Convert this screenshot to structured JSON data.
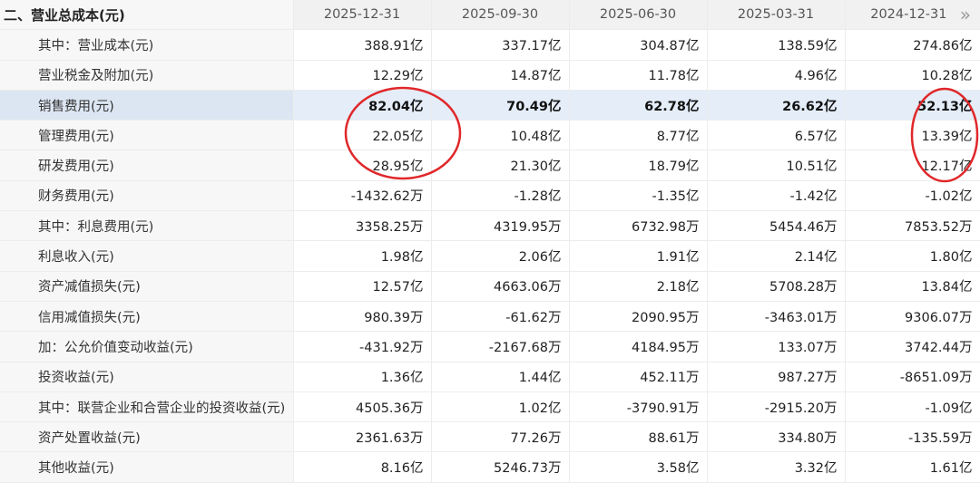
{
  "section_title": "二、营业总成本(元)",
  "dates": [
    "2025-12-31",
    "2025-09-30",
    "2025-06-30",
    "2025-03-31",
    "2024-12-31"
  ],
  "more_icon": "double-chevron-right-icon",
  "more_glyph": "»",
  "highlight_color": "#e4edf8",
  "annotation_color": "#e0272a",
  "rows": [
    {
      "label": "其中：营业成本(元)",
      "values": [
        "388.91亿",
        "337.17亿",
        "304.87亿",
        "138.59亿",
        "274.86亿"
      ]
    },
    {
      "label": "营业税金及附加(元)",
      "values": [
        "12.29亿",
        "14.87亿",
        "11.78亿",
        "4.96亿",
        "10.28亿"
      ]
    },
    {
      "label": "销售费用(元)",
      "values": [
        "82.04亿",
        "70.49亿",
        "62.78亿",
        "26.62亿",
        "52.13亿"
      ],
      "highlight": true
    },
    {
      "label": "管理费用(元)",
      "values": [
        "22.05亿",
        "10.48亿",
        "8.77亿",
        "6.57亿",
        "13.39亿"
      ]
    },
    {
      "label": "研发费用(元)",
      "values": [
        "28.95亿",
        "21.30亿",
        "18.79亿",
        "10.51亿",
        "12.17亿"
      ]
    },
    {
      "label": "财务费用(元)",
      "values": [
        "-1432.62万",
        "-1.28亿",
        "-1.35亿",
        "-1.42亿",
        "-1.02亿"
      ]
    },
    {
      "label": "其中：利息费用(元)",
      "values": [
        "3358.25万",
        "4319.95万",
        "6732.98万",
        "5454.46万",
        "7853.52万"
      ]
    },
    {
      "label": "利息收入(元)",
      "values": [
        "1.98亿",
        "2.06亿",
        "1.91亿",
        "2.14亿",
        "1.80亿"
      ]
    },
    {
      "label": "资产减值损失(元)",
      "values": [
        "12.57亿",
        "4663.06万",
        "2.18亿",
        "5708.28万",
        "13.84亿"
      ]
    },
    {
      "label": "信用减值损失(元)",
      "values": [
        "980.39万",
        "-61.62万",
        "2090.95万",
        "-3463.01万",
        "9306.07万"
      ]
    },
    {
      "label": "加：公允价值变动收益(元)",
      "values": [
        "-431.92万",
        "-2167.68万",
        "4184.95万",
        "133.07万",
        "3742.44万"
      ]
    },
    {
      "label": "投资收益(元)",
      "values": [
        "1.36亿",
        "1.44亿",
        "452.11万",
        "987.27万",
        "-8651.09万"
      ]
    },
    {
      "label": "其中：联营企业和合营企业的投资收益(元)",
      "values": [
        "4505.36万",
        "1.02亿",
        "-3790.91万",
        "-2915.20万",
        "-1.09亿"
      ]
    },
    {
      "label": "资产处置收益(元)",
      "values": [
        "2361.63万",
        "77.26万",
        "88.61万",
        "334.80万",
        "-135.59万"
      ]
    },
    {
      "label": "其他收益(元)",
      "values": [
        "8.16亿",
        "5246.73万",
        "3.58亿",
        "3.32亿",
        "1.61亿"
      ]
    }
  ]
}
